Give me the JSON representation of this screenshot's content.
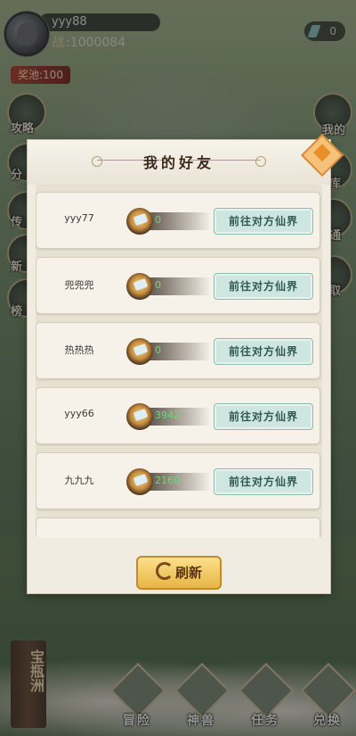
{
  "player": {
    "name": "yyy88",
    "power_label": "战",
    "power": ":1000084",
    "prize_pool": "奖池:100",
    "jade": "0"
  },
  "side_left": [
    "攻略",
    "分",
    "传",
    "新",
    "榜"
  ],
  "side_right": [
    "我的",
    "库",
    "通",
    "取"
  ],
  "modal": {
    "title": "我的好友",
    "friends": [
      {
        "name": "yyy77",
        "score": "0",
        "action": "前往对方仙界"
      },
      {
        "name": "兜兜兜",
        "score": "0",
        "action": "前往对方仙界"
      },
      {
        "name": "热热热",
        "score": "0",
        "action": "前往对方仙界"
      },
      {
        "name": "yyy66",
        "score": "3942",
        "action": "前往对方仙界"
      },
      {
        "name": "九九九",
        "score": "2160",
        "action": "前往对方仙界"
      }
    ],
    "refresh_label": "刷新"
  },
  "bottom": {
    "scroll_label": "宝瓶洲",
    "nav": [
      "冒险",
      "神兽",
      "任务",
      "兑换"
    ]
  },
  "colors": {
    "score_green": "#6fd67a",
    "go_button": "#cfe6e0",
    "refresh": "#e7b645"
  }
}
